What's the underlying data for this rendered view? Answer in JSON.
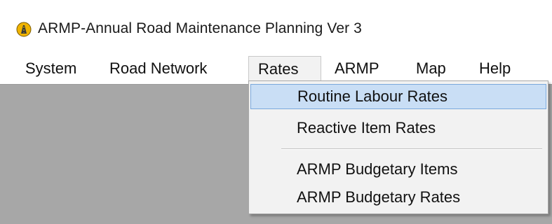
{
  "window": {
    "title": "ARMP-Annual Road Maintenance Planning Ver 3",
    "icon": "app-road-icon"
  },
  "menubar": {
    "items": [
      {
        "label": "System"
      },
      {
        "label": "Road Network"
      },
      {
        "label": "Rates"
      },
      {
        "label": "ARMP"
      },
      {
        "label": "Map"
      },
      {
        "label": "Help"
      }
    ],
    "open_menu": "Rates"
  },
  "rates_menu": {
    "items": [
      {
        "label": "Routine Labour Rates",
        "highlighted": true
      },
      {
        "label": "Reactive Item Rates",
        "highlighted": false
      },
      {
        "label": "ARMP Budgetary Items",
        "highlighted": false
      },
      {
        "label": "ARMP Budgetary Rates",
        "highlighted": false
      }
    ]
  },
  "colors": {
    "client_background": "#a7a7a7",
    "menu_background": "#f2f2f2",
    "highlight": "#c9def5",
    "highlight_border": "#7aa8dc"
  }
}
